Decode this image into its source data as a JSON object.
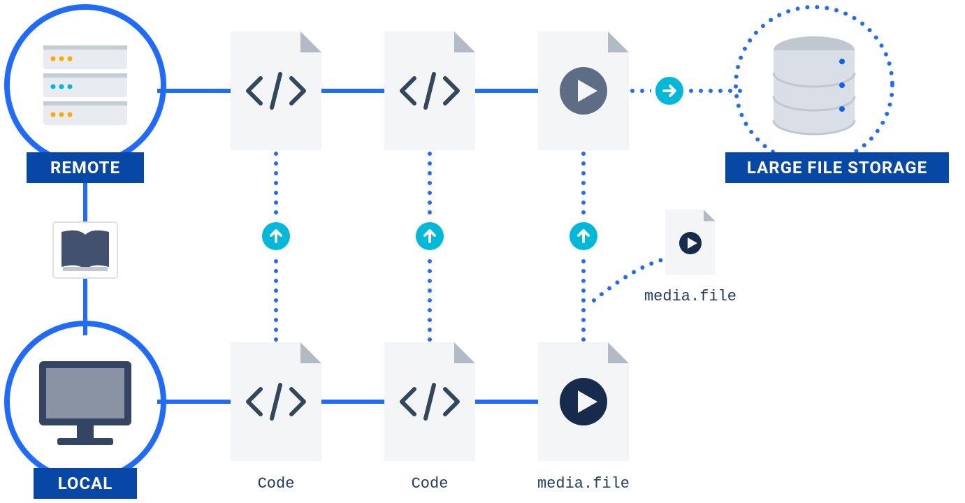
{
  "labels": {
    "remote": "REMOTE",
    "local": "LOCAL",
    "lfs": "LARGE FILE STORAGE",
    "local_code1": "Code",
    "local_code2": "Code",
    "local_media": "media.file",
    "pointer_media": "media.file"
  },
  "colors": {
    "brand_blue": "#1F6BFF",
    "deep_blue": "#0747A6",
    "teal": "#00B8D9",
    "navy": "#172B4D",
    "slate": "#5E6C84",
    "doc_bg": "#F4F5F7",
    "doc_fold": "#B3BAC5"
  }
}
